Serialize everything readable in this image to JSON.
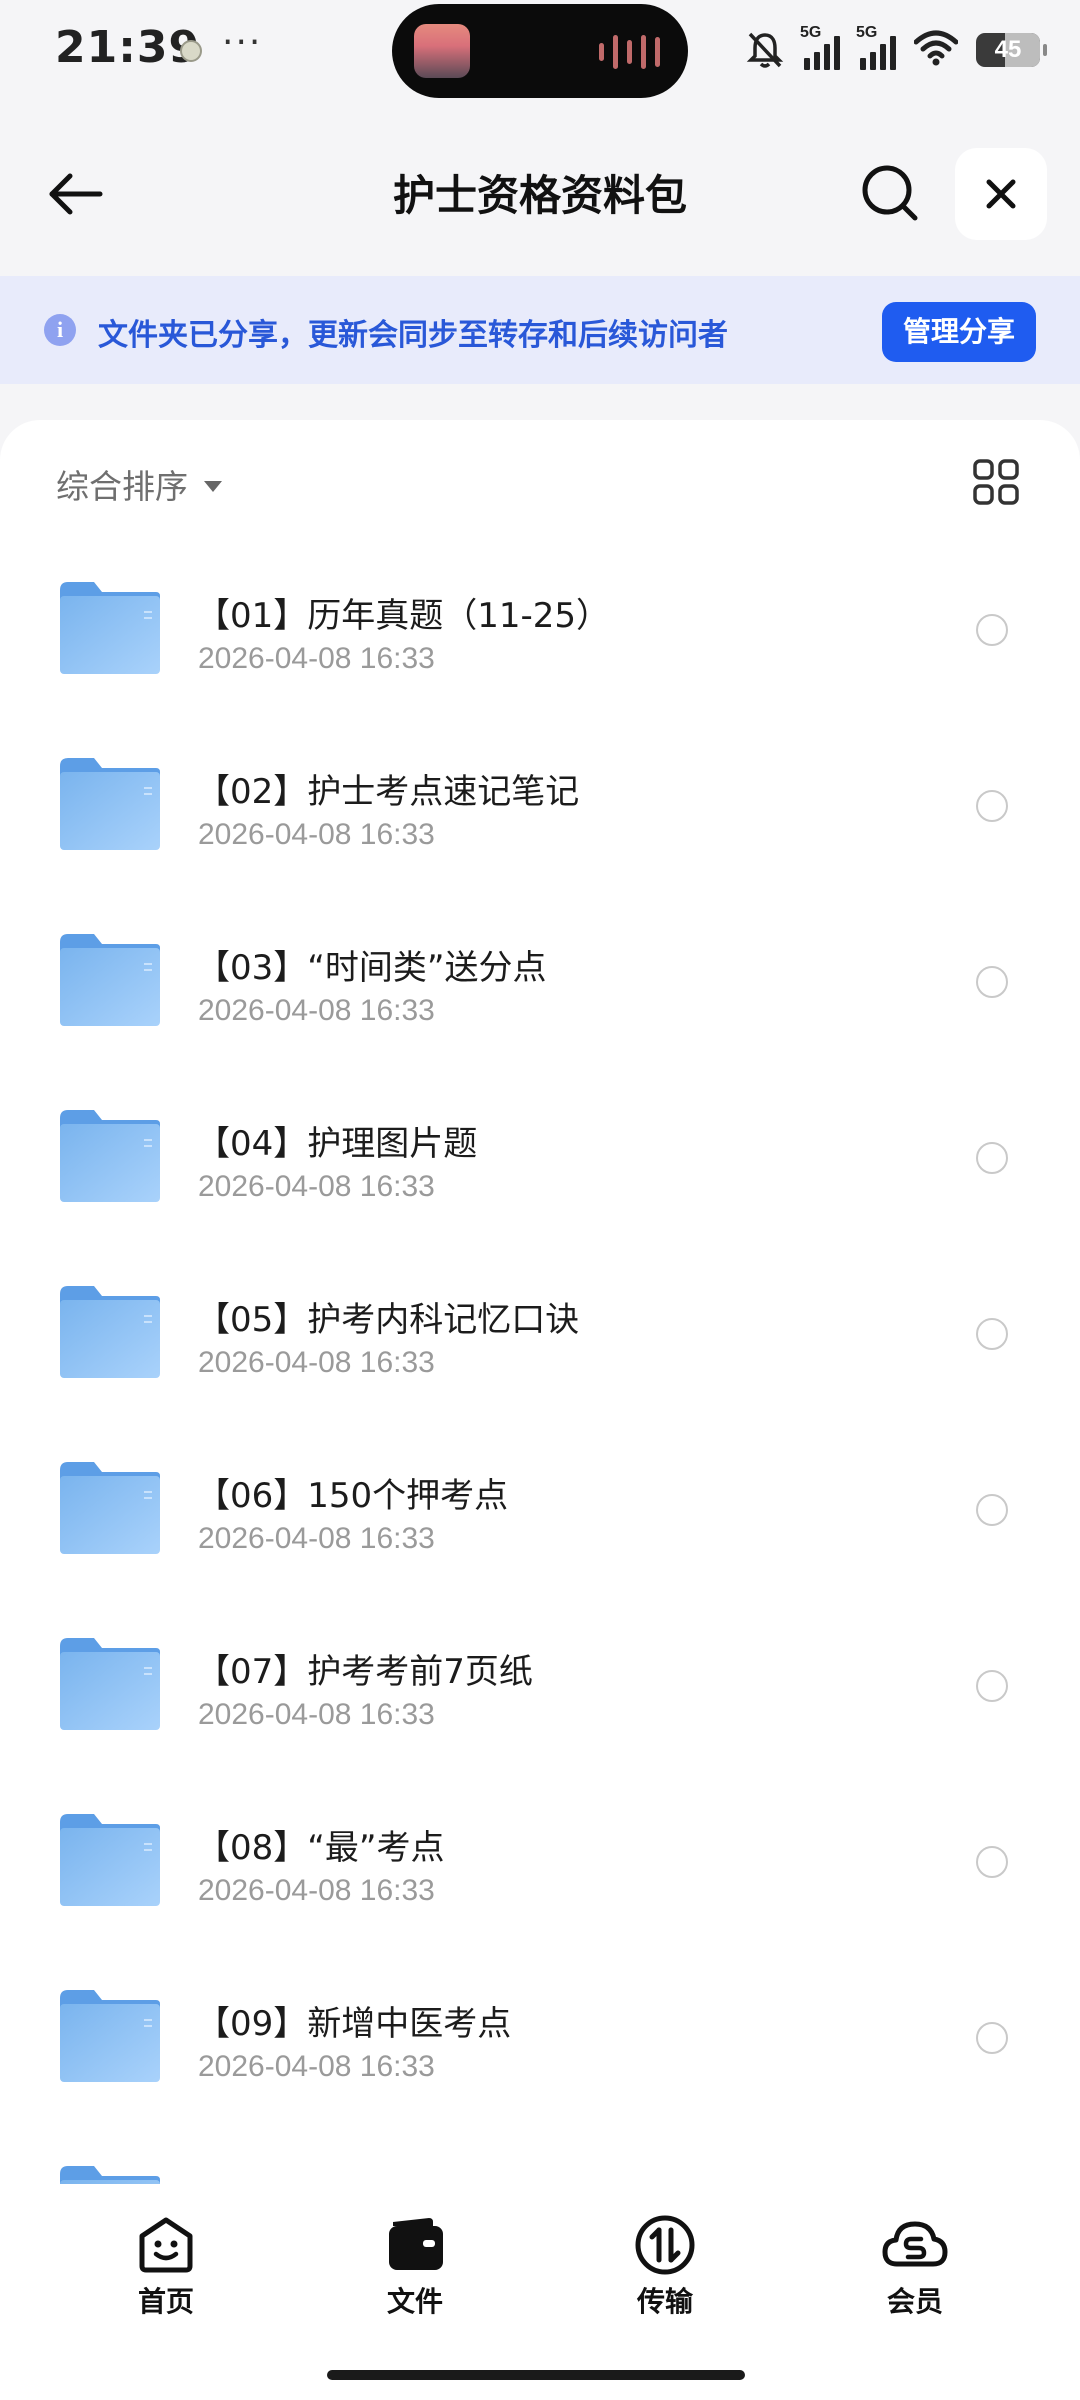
{
  "status_bar": {
    "time": "21:39",
    "more": "···",
    "network_1": "5G",
    "network_2": "5G",
    "battery_level": "45",
    "battery_fraction": 0.45
  },
  "header": {
    "title": "护士资格资料包",
    "back_icon": "back-arrow-icon",
    "search_icon": "search-icon",
    "close_icon": "close-icon"
  },
  "banner": {
    "text": "文件夹已分享，更新会同步至转存和后续访问者",
    "button": "管理分享"
  },
  "toolbar": {
    "sort_label": "综合排序",
    "view_icon": "grid-view-icon"
  },
  "files": [
    {
      "name": "【01】历年真题（11-25）",
      "date": "2026-04-08 16:33"
    },
    {
      "name": "【02】护士考点速记笔记",
      "date": "2026-04-08 16:33"
    },
    {
      "name": "【03】“时间类”送分点",
      "date": "2026-04-08 16:33"
    },
    {
      "name": "【04】护理图片题",
      "date": "2026-04-08 16:33"
    },
    {
      "name": "【05】护考内科记忆口诀",
      "date": "2026-04-08 16:33"
    },
    {
      "name": "【06】150个押考点",
      "date": "2026-04-08 16:33"
    },
    {
      "name": "【07】护考考前7页纸",
      "date": "2026-04-08 16:33"
    },
    {
      "name": "【08】“最”考点",
      "date": "2026-04-08 16:33"
    },
    {
      "name": "【09】新增中医考点",
      "date": "2026-04-08 16:33"
    }
  ],
  "tabs": [
    {
      "label": "首页",
      "icon": "home-smile-icon"
    },
    {
      "label": "文件",
      "icon": "wallet-folder-icon"
    },
    {
      "label": "传输",
      "icon": "transfer-icon"
    },
    {
      "label": "会员",
      "icon": "cloud-member-icon"
    }
  ],
  "colors": {
    "accent": "#1f5cf0",
    "banner_bg": "#e8ebfb",
    "banner_text": "#2958d8"
  }
}
